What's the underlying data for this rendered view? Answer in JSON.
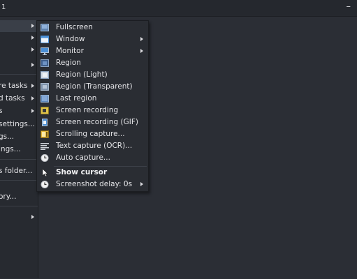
{
  "window": {
    "title_fragment": "1",
    "minimize_glyph": "–"
  },
  "main_menu": {
    "items": [
      {
        "label": "",
        "has_arrow": true,
        "highlight": true
      },
      {
        "label": "",
        "has_arrow": true
      },
      {
        "label": "",
        "has_arrow": true
      },
      {
        "label": "",
        "has_arrow": true
      },
      {
        "label": "re tasks",
        "has_arrow": true
      },
      {
        "label": "d tasks",
        "has_arrow": true
      },
      {
        "label": "s",
        "has_arrow": true
      },
      {
        "label": " settings...",
        "has_arrow": false
      },
      {
        "label": "gs...",
        "has_arrow": false
      },
      {
        "label": "ings...",
        "has_arrow": false
      },
      {
        "label": "s folder...",
        "has_arrow": false
      },
      {
        "label": "ory...",
        "has_arrow": false
      },
      {
        "label": "",
        "has_arrow": true
      }
    ]
  },
  "capture_submenu": {
    "items": [
      {
        "label": "Fullscreen",
        "icon": "fullscreen-icon",
        "has_arrow": false
      },
      {
        "label": "Window",
        "icon": "window-icon",
        "has_arrow": true
      },
      {
        "label": "Monitor",
        "icon": "monitor-icon",
        "has_arrow": true
      },
      {
        "label": "Region",
        "icon": "region-icon",
        "has_arrow": false
      },
      {
        "label": "Region (Light)",
        "icon": "region-light-icon",
        "has_arrow": false
      },
      {
        "label": "Region (Transparent)",
        "icon": "region-transparent-icon",
        "has_arrow": false
      },
      {
        "label": "Last region",
        "icon": "last-region-icon",
        "has_arrow": false
      },
      {
        "label": "Screen recording",
        "icon": "screen-recording-icon",
        "has_arrow": false
      },
      {
        "label": "Screen recording (GIF)",
        "icon": "gif-recording-icon",
        "has_arrow": false
      },
      {
        "label": "Scrolling capture...",
        "icon": "scrolling-capture-icon",
        "has_arrow": false
      },
      {
        "label": "Text capture (OCR)...",
        "icon": "ocr-icon",
        "has_arrow": false
      },
      {
        "label": "Auto capture...",
        "icon": "clock-icon",
        "has_arrow": false
      },
      {
        "label": "Show cursor",
        "icon": "cursor-icon",
        "has_arrow": false,
        "bold": true
      },
      {
        "label": "Screenshot delay: 0s",
        "icon": "clock-icon",
        "has_arrow": true
      }
    ]
  },
  "colors": {
    "background": "#2b2e35",
    "menu": "#2a2d33",
    "highlight": "#3a3f48",
    "icon_blue": "#4a8fd6"
  }
}
